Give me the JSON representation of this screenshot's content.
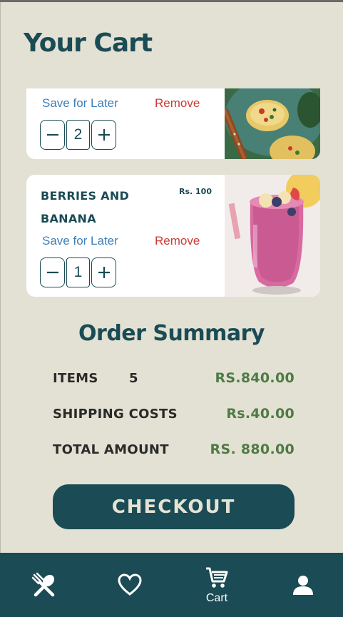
{
  "page": {
    "title": "Your Cart"
  },
  "colors": {
    "primary": "#1b4b55",
    "background": "#e2e1d3",
    "price_green": "#4f7a45",
    "save_link": "#3f7fb8",
    "remove_link": "#cc3b35"
  },
  "cart": {
    "items": [
      {
        "name": "",
        "price": "",
        "save_label": "Save for Later",
        "remove_label": "Remove",
        "quantity": "2",
        "image": "egg-muffins-photo"
      },
      {
        "name": "BERRIES AND BANANA",
        "price": "Rs. 100",
        "save_label": "Save for Later",
        "remove_label": "Remove",
        "quantity": "1",
        "image": "berry-smoothie-photo"
      }
    ],
    "decrement_icon": "minus-icon",
    "increment_icon": "plus-icon"
  },
  "summary": {
    "title": "Order Summary",
    "items_label": "ITEMS",
    "items_count": "5",
    "items_value": "RS.840.00",
    "shipping_label": "SHIPPING COSTS",
    "shipping_value": "Rs.40.00",
    "total_label": "TOTAL AMOUNT",
    "total_value": "RS. 880.00"
  },
  "checkout": {
    "label": "CHECKOUT"
  },
  "nav": {
    "items": [
      {
        "icon": "fork-spoon-icon",
        "label": ""
      },
      {
        "icon": "heart-icon",
        "label": ""
      },
      {
        "icon": "cart-icon",
        "label": "Cart"
      },
      {
        "icon": "user-icon",
        "label": ""
      }
    ]
  }
}
